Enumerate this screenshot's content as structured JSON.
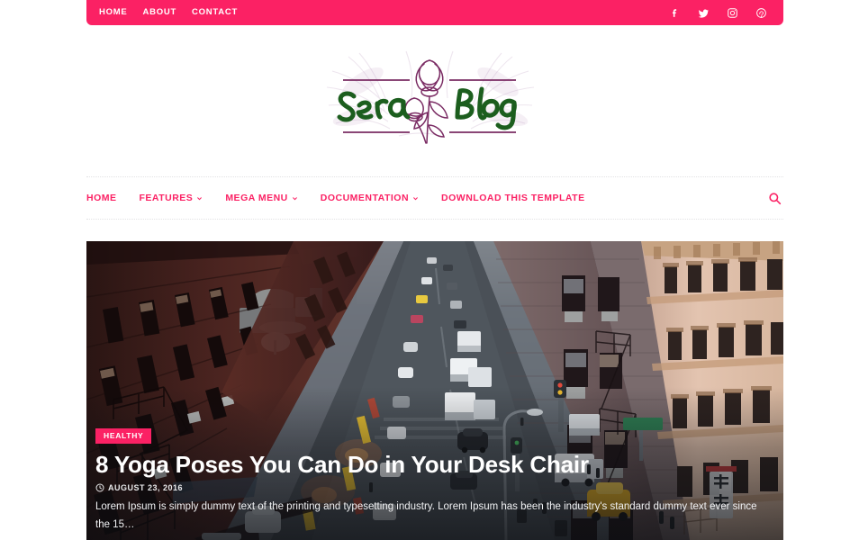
{
  "colors": {
    "brand_pink": "#fb2164",
    "logo_green": "#1c5e1e",
    "logo_purple": "#7a2b63",
    "nav_dotted_border": "#e2e2e4",
    "white": "#ffffff"
  },
  "topbar": {
    "links": [
      {
        "label": "HOME",
        "name": "topbar-link-home"
      },
      {
        "label": "ABOUT",
        "name": "topbar-link-about"
      },
      {
        "label": "CONTACT",
        "name": "topbar-link-contact"
      }
    ],
    "social": [
      {
        "label": "facebook-icon"
      },
      {
        "label": "twitter-icon"
      },
      {
        "label": "instagram-icon"
      },
      {
        "label": "pinterest-icon"
      }
    ]
  },
  "logo": {
    "text_left": "Sera",
    "text_right": "Blog",
    "full_text": "Sera Blog",
    "decoration": "flower-illustration"
  },
  "mainnav": {
    "items": [
      {
        "label": "HOME",
        "has_caret": false
      },
      {
        "label": "FEATURES",
        "has_caret": true
      },
      {
        "label": "MEGA MENU",
        "has_caret": true
      },
      {
        "label": "DOCUMENTATION",
        "has_caret": true
      },
      {
        "label": "DOWNLOAD THIS TEMPLATE",
        "has_caret": false
      }
    ],
    "search_icon": "search-icon"
  },
  "hero": {
    "category": "HEALTHY",
    "title": "8 Yoga Poses You Can Do in Your Desk Chair",
    "date": "AUGUST 23, 2016",
    "date_icon": "clock-icon",
    "excerpt": "Lorem Ipsum is simply dummy text of the printing and typesetting industry. Lorem Ipsum has been the industry's standard dummy text ever since the 15…",
    "image_description": "aerial view of a busy city street between brick and stone buildings"
  }
}
